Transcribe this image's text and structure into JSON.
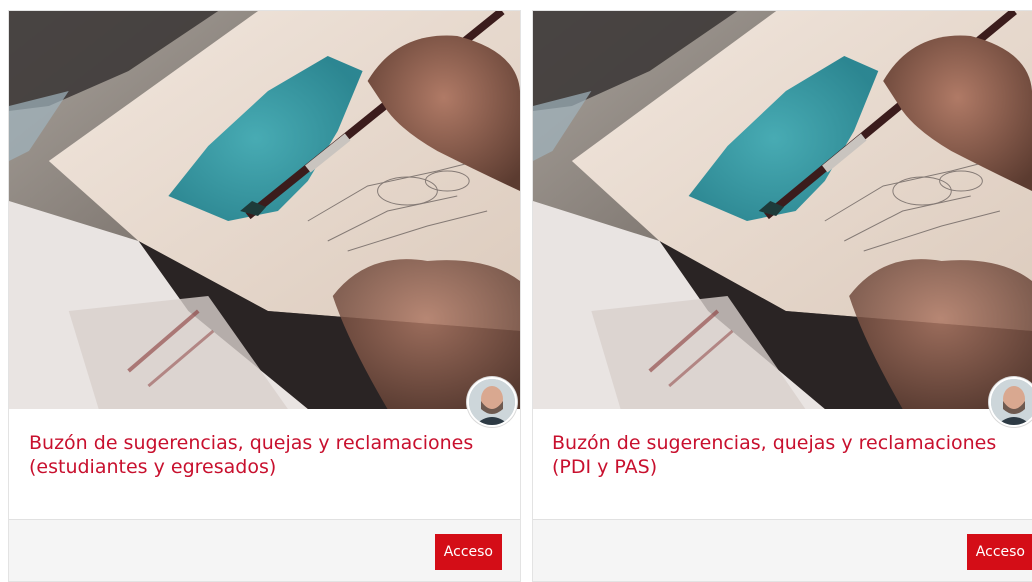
{
  "cards": [
    {
      "image_alt": "painting-photo",
      "title": "Buzón de sugerencias, quejas y reclamaciones (estudiantes y egresados)",
      "button_label": "Acceso"
    },
    {
      "image_alt": "painting-photo",
      "title": "Buzón de sugerencias, quejas y reclamaciones (PDI y PAS)",
      "button_label": "Acceso"
    }
  ],
  "colors": {
    "title": "#c8102e",
    "button": "#d40d17",
    "footer": "#f5f5f5"
  }
}
